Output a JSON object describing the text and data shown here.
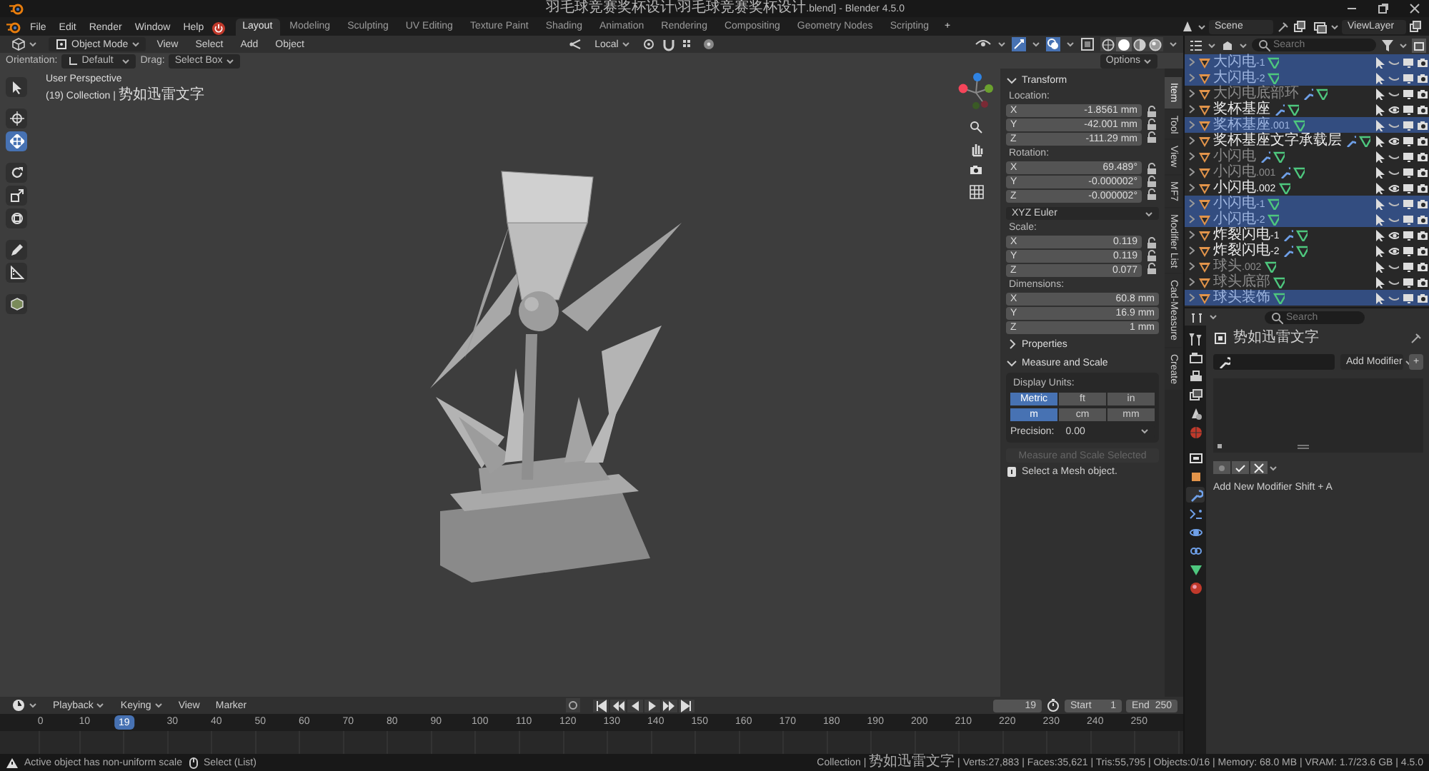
{
  "window": {
    "title": "羽毛球竞赛奖杯设计\\羽毛球竞赛奖杯设计.blend] - Blender 4.5.0"
  },
  "menus": [
    "File",
    "Edit",
    "Render",
    "Window",
    "Help"
  ],
  "workspaces": [
    {
      "label": "Layout",
      "selected": true
    },
    {
      "label": "Modeling",
      "selected": false
    },
    {
      "label": "Sculpting",
      "selected": false
    },
    {
      "label": "UV Editing",
      "selected": false
    },
    {
      "label": "Texture Paint",
      "selected": false
    },
    {
      "label": "Shading",
      "selected": false
    },
    {
      "label": "Animation",
      "selected": false
    },
    {
      "label": "Rendering",
      "selected": false
    },
    {
      "label": "Compositing",
      "selected": false
    },
    {
      "label": "Geometry Nodes",
      "selected": false
    },
    {
      "label": "Scripting",
      "selected": false
    }
  ],
  "add_workspace": "+",
  "scene": {
    "name": "Scene"
  },
  "view_layer": {
    "name": "ViewLayer"
  },
  "viewport": {
    "mode": "Object Mode",
    "menus": [
      "View",
      "Select",
      "Add",
      "Object"
    ],
    "pivot": "Local",
    "orientation_label": "Orientation:",
    "orientation": "Default",
    "drag_label": "Drag:",
    "drag": "Select Box",
    "options": "Options",
    "shading": [
      {
        "selected": false
      },
      {
        "selected": true
      },
      {
        "selected": false
      },
      {
        "selected": false
      }
    ],
    "tools": [
      {
        "kind": "select",
        "selected": false
      },
      {
        "kind": "cursor",
        "selected": false
      },
      {
        "kind": "move",
        "selected": true
      },
      {
        "kind": "rotate",
        "selected": false
      },
      {
        "kind": "scale",
        "selected": false
      },
      {
        "kind": "transform",
        "selected": false
      },
      {
        "kind": "annotate",
        "selected": false
      },
      {
        "kind": "measure",
        "selected": false
      },
      {
        "kind": "add-cube",
        "selected": false
      }
    ],
    "info": [
      "User Perspective",
      "(19) Collection | 势如迅雷文字"
    ]
  },
  "sidebar": {
    "tabs": [
      {
        "label": "Item",
        "selected": true
      },
      {
        "label": "Tool",
        "selected": false
      },
      {
        "label": "View",
        "selected": false
      },
      {
        "label": "MF7",
        "selected": false
      },
      {
        "label": "Modifier List",
        "selected": false
      },
      {
        "label": "Cad-Measure",
        "selected": false
      },
      {
        "label": "Create",
        "selected": false
      }
    ],
    "panels": [
      {
        "kind": "transform",
        "title": "Transform",
        "expanded": true,
        "groups": [
          {
            "label": "Location:",
            "locks": true,
            "fields": [
              {
                "axis": "X",
                "value": "-1.8561 mm"
              },
              {
                "axis": "Y",
                "value": "-42.001 mm"
              },
              {
                "axis": "Z",
                "value": "-111.29 mm"
              }
            ]
          },
          {
            "label": "Rotation:",
            "locks": true,
            "fields": [
              {
                "axis": "X",
                "value": "69.489°"
              },
              {
                "axis": "Y",
                "value": "-0.000002°"
              },
              {
                "axis": "Z",
                "value": "-0.000002°"
              }
            ],
            "mode": "XYZ Euler"
          },
          {
            "label": "Scale:",
            "locks": true,
            "fields": [
              {
                "axis": "X",
                "value": "0.119"
              },
              {
                "axis": "Y",
                "value": "0.119"
              },
              {
                "axis": "Z",
                "value": "0.077"
              }
            ]
          },
          {
            "label": "Dimensions:",
            "locks": false,
            "fields": [
              {
                "axis": "X",
                "value": "60.8 mm"
              },
              {
                "axis": "Y",
                "value": "16.9 mm"
              },
              {
                "axis": "Z",
                "value": "1 mm"
              }
            ]
          }
        ]
      },
      {
        "kind": "plain",
        "title": "Properties",
        "expanded": false
      },
      {
        "kind": "measure",
        "title": "Measure and Scale",
        "expanded": true,
        "units_label": "Display Units:",
        "systems": [
          {
            "label": "Metric",
            "selected": true
          },
          {
            "label": "ft",
            "selected": false
          },
          {
            "label": "in",
            "selected": false
          }
        ],
        "units": [
          {
            "label": "m",
            "selected": true
          },
          {
            "label": "cm",
            "selected": false
          },
          {
            "label": "mm",
            "selected": false
          }
        ],
        "precision_label": "Precision:",
        "precision": "0.00",
        "button": {
          "label": "Measure and Scale Selected",
          "disabled": true
        },
        "info": "Select a Mesh object."
      }
    ]
  },
  "outliner": {
    "search": {
      "placeholder": "Search"
    },
    "rows": [
      {
        "name": "大闪电-1",
        "selected": true,
        "visible": false,
        "modifier": false
      },
      {
        "name": "大闪电-2",
        "selected": true,
        "visible": false,
        "modifier": false
      },
      {
        "name": "大闪电底部环",
        "selected": false,
        "visible": false,
        "modifier": true
      },
      {
        "name": "奖杯基座",
        "selected": false,
        "visible": true,
        "modifier": true
      },
      {
        "name": "奖杯基座.001",
        "selected": true,
        "visible": false,
        "modifier": false
      },
      {
        "name": "奖杯基座文字承载层",
        "selected": false,
        "visible": true,
        "modifier": true
      },
      {
        "name": "小闪电",
        "selected": false,
        "visible": false,
        "modifier": true
      },
      {
        "name": "小闪电.001",
        "selected": false,
        "visible": false,
        "modifier": true
      },
      {
        "name": "小闪电.002",
        "selected": false,
        "visible": true,
        "modifier": false
      },
      {
        "name": "小闪电-1",
        "selected": true,
        "visible": false,
        "modifier": false
      },
      {
        "name": "小闪电-2",
        "selected": true,
        "visible": false,
        "modifier": false
      },
      {
        "name": "炸裂闪电-1",
        "selected": false,
        "visible": true,
        "modifier": true
      },
      {
        "name": "炸裂闪电-2",
        "selected": false,
        "visible": true,
        "modifier": true
      },
      {
        "name": "球头.002",
        "selected": false,
        "visible": false,
        "modifier": false
      },
      {
        "name": "球头底部",
        "selected": false,
        "visible": false,
        "modifier": false
      },
      {
        "name": "球头装饰",
        "selected": true,
        "visible": false,
        "modifier": false
      }
    ]
  },
  "properties": {
    "search": {
      "placeholder": "Search"
    },
    "tabs": [
      {
        "kind": "tool",
        "selected": false
      },
      {
        "kind": "render",
        "selected": false
      },
      {
        "kind": "output",
        "selected": false
      },
      {
        "kind": "view",
        "selected": false
      },
      {
        "kind": "scene",
        "selected": false
      },
      {
        "kind": "world",
        "selected": false
      },
      {
        "kind": "collection",
        "selected": false
      },
      {
        "kind": "object",
        "selected": false
      },
      {
        "kind": "modifier",
        "selected": true
      },
      {
        "kind": "particles",
        "selected": false
      },
      {
        "kind": "physics",
        "selected": false
      },
      {
        "kind": "constraints",
        "selected": false
      },
      {
        "kind": "data",
        "selected": false
      },
      {
        "kind": "material",
        "selected": false
      }
    ],
    "object_name": "势如迅雷文字",
    "add_modifier": "Add Modifier",
    "add_button": "+",
    "hint": "Add New Modifier Shift + A"
  },
  "timeline": {
    "menus": [
      "Playback",
      "Keying",
      "View",
      "Marker"
    ],
    "current_frame": "19",
    "start_label": "Start",
    "start": "1",
    "end_label": "End",
    "end": "250",
    "ticks": [
      "0",
      "10",
      "30",
      "40",
      "50",
      "60",
      "70",
      "80",
      "90",
      "100",
      "110",
      "120",
      "130",
      "140",
      "150",
      "160",
      "170",
      "180",
      "190",
      "200",
      "210",
      "220",
      "230",
      "240",
      "250"
    ],
    "playhead": "19"
  },
  "status": {
    "message": "Active object has non-uniform scale",
    "action": "Select (List)",
    "stats": "Collection | 势如迅雷文字 | Verts:27,883 | Faces:35,621 | Tris:55,795 | Objects:0/16 | Memory: 68.0 MB | VRAM: 1.7/23.6 GB | 4.5.0"
  }
}
